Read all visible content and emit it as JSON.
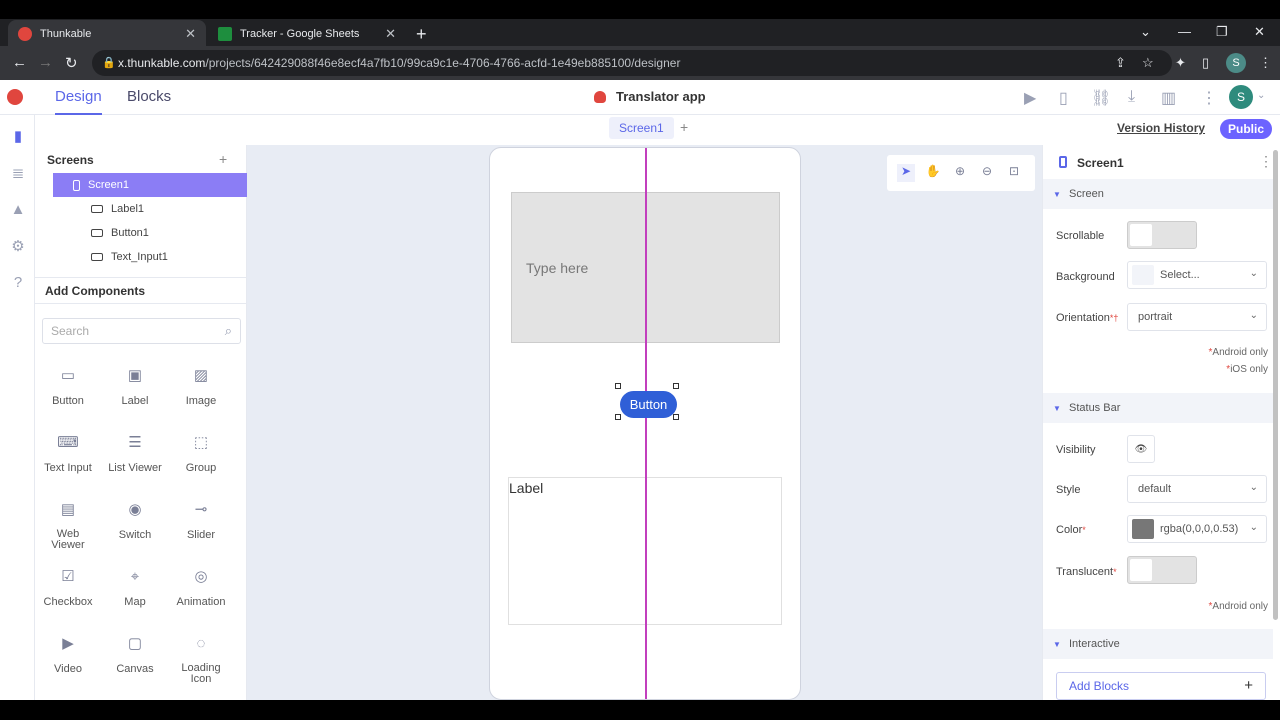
{
  "browser": {
    "tabs": [
      {
        "title": "Thunkable",
        "close": "✕",
        "favicon_color": "#e0463e",
        "active": true
      },
      {
        "title": "Tracker - Google Sheets",
        "close": "✕",
        "favicon_color": "#1e8e3e",
        "active": false
      }
    ],
    "url_host": "x.thunkable.com",
    "url_path": "/projects/642429088f46e8ecf4a7fb10/99ca9c1e-4706-4766-acfd-1e49eb885100/designer",
    "profile_initial": "S"
  },
  "header": {
    "modes": {
      "design": "Design",
      "blocks": "Blocks"
    },
    "app_title": "Translator app",
    "user_initial": "S"
  },
  "screenbar": {
    "screen_tab": "Screen1",
    "version_history": "Version History",
    "public": "Public"
  },
  "screens_panel": {
    "title": "Screens",
    "tree": [
      {
        "label": "Screen1",
        "selected": true
      },
      {
        "label": "Label1",
        "selected": false
      },
      {
        "label": "Button1",
        "selected": false
      },
      {
        "label": "Text_Input1",
        "selected": false
      }
    ]
  },
  "components_panel": {
    "title": "Add Components",
    "search_placeholder": "Search",
    "items": [
      {
        "label": "Button",
        "icon": "button-icon"
      },
      {
        "label": "Label",
        "icon": "label-icon"
      },
      {
        "label": "Image",
        "icon": "image-icon"
      },
      {
        "label": "Text Input",
        "icon": "text-input-icon"
      },
      {
        "label": "List Viewer",
        "icon": "list-icon"
      },
      {
        "label": "Group",
        "icon": "group-icon"
      },
      {
        "label": "Web Viewer",
        "icon": "web-viewer-icon"
      },
      {
        "label": "Switch",
        "icon": "switch-icon"
      },
      {
        "label": "Slider",
        "icon": "slider-icon"
      },
      {
        "label": "Checkbox",
        "icon": "checkbox-icon"
      },
      {
        "label": "Map",
        "icon": "map-icon"
      },
      {
        "label": "Animation",
        "icon": "animation-icon"
      },
      {
        "label": "Video",
        "icon": "video-icon"
      },
      {
        "label": "Canvas",
        "icon": "canvas-icon"
      },
      {
        "label": "Loading Icon",
        "icon": "loading-icon"
      }
    ]
  },
  "canvas": {
    "text_input_placeholder": "Type here",
    "button_text": "Button",
    "label_text": "Label"
  },
  "properties": {
    "title": "Screen1",
    "sections": {
      "screen": "Screen",
      "status_bar": "Status Bar",
      "interactive": "Interactive"
    },
    "scrollable": "Scrollable",
    "background": "Background",
    "background_value": "Select...",
    "orientation": "Orientation",
    "orientation_value": "portrait",
    "android_only": "Android only",
    "ios_only": "iOS only",
    "visibility": "Visibility",
    "style": "Style",
    "style_value": "default",
    "color": "Color",
    "color_value": "rgba(0,0,0,0.53)",
    "color_swatch": "#777777",
    "translucent": "Translucent",
    "android_only_2": "Android only",
    "add_blocks": "Add Blocks"
  },
  "colors": {
    "accent": "#5b67e8",
    "selected_tree": "#8b7df5",
    "button_blue": "#2f5fd7",
    "guide_magenta": "#c23fbd"
  }
}
